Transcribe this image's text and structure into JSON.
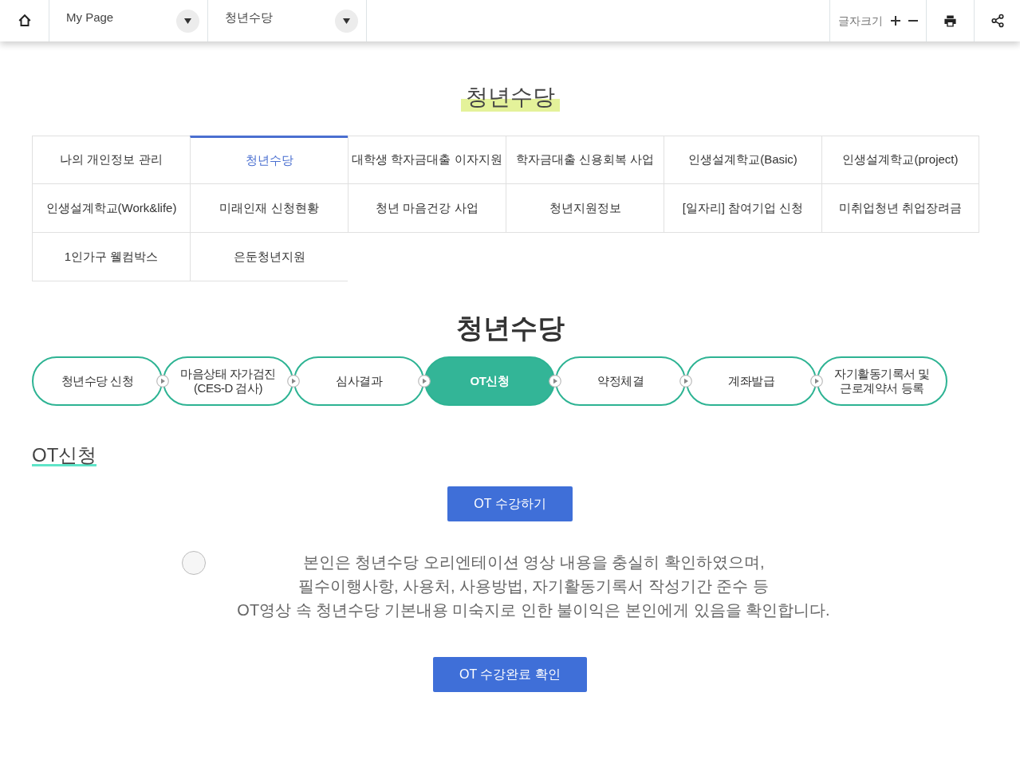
{
  "topbar": {
    "breadcrumbs": [
      {
        "label": "My Page"
      },
      {
        "label": "청년수당"
      }
    ],
    "font_size_label": "글자크기"
  },
  "page_title": "청년수당",
  "menu": [
    {
      "label": "나의 개인정보 관리",
      "selected": false
    },
    {
      "label": "청년수당",
      "selected": true
    },
    {
      "label": "대학생 학자금대출 이자지원",
      "selected": false
    },
    {
      "label": "학자금대출 신용회복 사업",
      "selected": false
    },
    {
      "label": "인생설계학교(Basic)",
      "selected": false
    },
    {
      "label": "인생설계학교(project)",
      "selected": false
    },
    {
      "label": "인생설계학교(Work&life)",
      "selected": false
    },
    {
      "label": "미래인재 신청현황",
      "selected": false
    },
    {
      "label": "청년 마음건강 사업",
      "selected": false
    },
    {
      "label": "청년지원정보",
      "selected": false
    },
    {
      "label": "[일자리] 참여기업 신청",
      "selected": false
    },
    {
      "label": "미취업청년 취업장려금",
      "selected": false
    },
    {
      "label": "1인가구 웰컴박스",
      "selected": false
    },
    {
      "label": "은둔청년지원",
      "selected": false
    }
  ],
  "section_title": "청년수당",
  "steps": [
    {
      "lines": [
        "청년수당 신청"
      ],
      "selected": false
    },
    {
      "lines": [
        "마음상태 자가검진",
        "(CES-D 검사)"
      ],
      "selected": false
    },
    {
      "lines": [
        "심사결과"
      ],
      "selected": false
    },
    {
      "lines": [
        "OT신청"
      ],
      "selected": true
    },
    {
      "lines": [
        "약정체결"
      ],
      "selected": false
    },
    {
      "lines": [
        "계좌발급"
      ],
      "selected": false
    },
    {
      "lines": [
        "자기활동기록서 및",
        "근로계약서 등록"
      ],
      "selected": false
    }
  ],
  "subsection_title": "OT신청",
  "watch_button": "OT 수강하기",
  "agreement": {
    "checked": false,
    "lines": [
      "본인은 청년수당 오리엔테이션 영상 내용을 충실히 확인하였으며,",
      "필수이행사항, 사용처, 사용방법, 자기활동기록서 작성기간 준수 등",
      "OT영상 속 청년수당 기본내용 미숙지로 인한 불이익은 본인에게 있음을 확인합니다."
    ]
  },
  "confirm_button": "OT 수강완료 확인"
}
